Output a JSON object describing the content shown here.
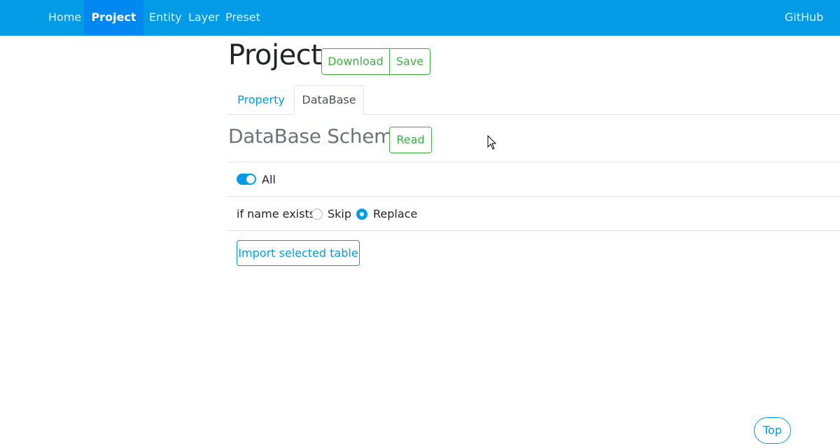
{
  "nav": {
    "items": [
      {
        "label": "Home"
      },
      {
        "label": "Project"
      },
      {
        "label": "Entity"
      },
      {
        "label": "Layer"
      },
      {
        "label": "Preset"
      }
    ],
    "active": "Project",
    "right_link": "GitHub"
  },
  "header": {
    "title": "Project",
    "download_label": "Download",
    "save_label": "Save"
  },
  "tabs": [
    {
      "label": "Property",
      "active": false
    },
    {
      "label": "DataBase",
      "active": true
    }
  ],
  "schema": {
    "title": "DataBase Schema",
    "read_label": "Read"
  },
  "options": {
    "all_label": "All",
    "all_checked": true,
    "if_name_exists_label": "if name exists",
    "skip_label": "Skip",
    "replace_label": "Replace",
    "selected": "Replace"
  },
  "import_label": "Import selected table",
  "top_label": "Top",
  "colors": {
    "navbar": "#039be5",
    "nav_active": "#0288f0",
    "success": "#3cb043",
    "primary": "#039be5"
  }
}
